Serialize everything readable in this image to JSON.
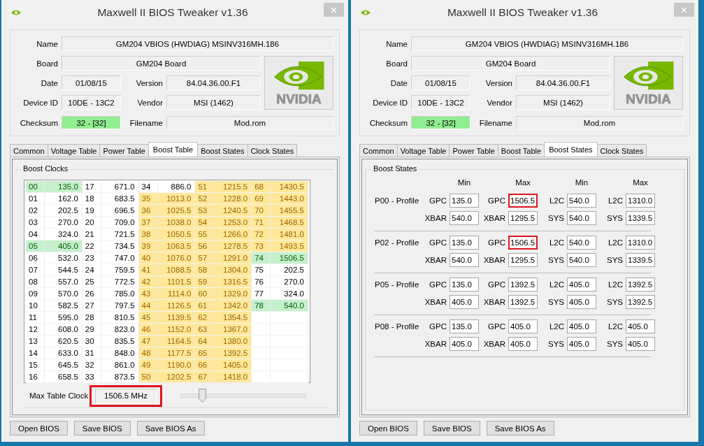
{
  "windows": [
    {
      "title": "Maxwell II BIOS Tweaker v1.36",
      "info": {
        "name": {
          "label": "Name",
          "value": "GM204 VBIOS (HWDIAG) MSINV316MH.186"
        },
        "board": {
          "label": "Board",
          "value": "GM204 Board"
        },
        "date": {
          "label": "Date",
          "value": "01/08/15"
        },
        "version": {
          "label": "Version",
          "value": "84.04.36.00.F1"
        },
        "device_id": {
          "label": "Device ID",
          "value": "10DE - 13C2"
        },
        "vendor": {
          "label": "Vendor",
          "value": "MSI (1462)"
        },
        "checksum": {
          "label": "Checksum",
          "value": "32 - [32]",
          "highlight": true
        },
        "filename": {
          "label": "Filename",
          "value": "Mod.rom"
        },
        "logo_text": "NVIDIA"
      },
      "tabs": [
        {
          "label": "Common",
          "selected": false
        },
        {
          "label": "Voltage Table",
          "selected": false
        },
        {
          "label": "Power Table",
          "selected": false
        },
        {
          "label": "Boost Table",
          "selected": true
        },
        {
          "label": "Boost States",
          "selected": false
        },
        {
          "label": "Clock States",
          "selected": false
        }
      ],
      "panel": {
        "kind": "boost_table",
        "title": "Boost Clocks",
        "entries": [
          {
            "id": "00",
            "clock": "135.0",
            "kind": "marked"
          },
          {
            "id": "01",
            "clock": "162.0",
            "kind": "plain"
          },
          {
            "id": "02",
            "clock": "202.5",
            "kind": "plain"
          },
          {
            "id": "03",
            "clock": "270.0",
            "kind": "plain"
          },
          {
            "id": "04",
            "clock": "324.0",
            "kind": "plain"
          },
          {
            "id": "05",
            "clock": "405.0",
            "kind": "marked"
          },
          {
            "id": "06",
            "clock": "532.0",
            "kind": "plain"
          },
          {
            "id": "07",
            "clock": "544.5",
            "kind": "plain"
          },
          {
            "id": "08",
            "clock": "557.0",
            "kind": "plain"
          },
          {
            "id": "09",
            "clock": "570.0",
            "kind": "plain"
          },
          {
            "id": "10",
            "clock": "582.5",
            "kind": "plain"
          },
          {
            "id": "11",
            "clock": "595.0",
            "kind": "plain"
          },
          {
            "id": "12",
            "clock": "608.0",
            "kind": "plain"
          },
          {
            "id": "13",
            "clock": "620.5",
            "kind": "plain"
          },
          {
            "id": "14",
            "clock": "633.0",
            "kind": "plain"
          },
          {
            "id": "15",
            "clock": "645.5",
            "kind": "plain"
          },
          {
            "id": "16",
            "clock": "658.5",
            "kind": "plain"
          },
          {
            "id": "17",
            "clock": "671.0",
            "kind": "plain"
          },
          {
            "id": "18",
            "clock": "683.5",
            "kind": "plain"
          },
          {
            "id": "19",
            "clock": "696.5",
            "kind": "plain"
          },
          {
            "id": "20",
            "clock": "709.0",
            "kind": "plain"
          },
          {
            "id": "21",
            "clock": "721.5",
            "kind": "plain"
          },
          {
            "id": "22",
            "clock": "734.5",
            "kind": "plain"
          },
          {
            "id": "23",
            "clock": "747.0",
            "kind": "plain"
          },
          {
            "id": "24",
            "clock": "759.5",
            "kind": "plain"
          },
          {
            "id": "25",
            "clock": "772.5",
            "kind": "plain"
          },
          {
            "id": "26",
            "clock": "785.0",
            "kind": "plain"
          },
          {
            "id": "27",
            "clock": "797.5",
            "kind": "plain"
          },
          {
            "id": "28",
            "clock": "810.5",
            "kind": "plain"
          },
          {
            "id": "29",
            "clock": "823.0",
            "kind": "plain"
          },
          {
            "id": "30",
            "clock": "835.5",
            "kind": "plain"
          },
          {
            "id": "31",
            "clock": "848.0",
            "kind": "plain"
          },
          {
            "id": "32",
            "clock": "861.0",
            "kind": "plain"
          },
          {
            "id": "33",
            "clock": "873.5",
            "kind": "plain"
          },
          {
            "id": "34",
            "clock": "886.0",
            "kind": "plain"
          },
          {
            "id": "35",
            "clock": "1013.0",
            "kind": "range"
          },
          {
            "id": "36",
            "clock": "1025.5",
            "kind": "range"
          },
          {
            "id": "37",
            "clock": "1038.0",
            "kind": "range"
          },
          {
            "id": "38",
            "clock": "1050.5",
            "kind": "range"
          },
          {
            "id": "39",
            "clock": "1063.5",
            "kind": "range"
          },
          {
            "id": "40",
            "clock": "1076.0",
            "kind": "range"
          },
          {
            "id": "41",
            "clock": "1088.5",
            "kind": "range"
          },
          {
            "id": "42",
            "clock": "1101.5",
            "kind": "range"
          },
          {
            "id": "43",
            "clock": "1114.0",
            "kind": "range"
          },
          {
            "id": "44",
            "clock": "1126.5",
            "kind": "range"
          },
          {
            "id": "45",
            "clock": "1139.5",
            "kind": "range"
          },
          {
            "id": "46",
            "clock": "1152.0",
            "kind": "range"
          },
          {
            "id": "47",
            "clock": "1164.5",
            "kind": "range"
          },
          {
            "id": "48",
            "clock": "1177.5",
            "kind": "range"
          },
          {
            "id": "49",
            "clock": "1190.0",
            "kind": "range"
          },
          {
            "id": "50",
            "clock": "1202.5",
            "kind": "range"
          },
          {
            "id": "51",
            "clock": "1215.5",
            "kind": "range"
          },
          {
            "id": "52",
            "clock": "1228.0",
            "kind": "range"
          },
          {
            "id": "53",
            "clock": "1240.5",
            "kind": "range"
          },
          {
            "id": "54",
            "clock": "1253.0",
            "kind": "range"
          },
          {
            "id": "55",
            "clock": "1266.0",
            "kind": "range"
          },
          {
            "id": "56",
            "clock": "1278.5",
            "kind": "range"
          },
          {
            "id": "57",
            "clock": "1291.0",
            "kind": "range"
          },
          {
            "id": "58",
            "clock": "1304.0",
            "kind": "range"
          },
          {
            "id": "59",
            "clock": "1316.5",
            "kind": "range"
          },
          {
            "id": "60",
            "clock": "1329.0",
            "kind": "range"
          },
          {
            "id": "61",
            "clock": "1342.0",
            "kind": "range"
          },
          {
            "id": "62",
            "clock": "1354.5",
            "kind": "range"
          },
          {
            "id": "63",
            "clock": "1367.0",
            "kind": "range"
          },
          {
            "id": "64",
            "clock": "1380.0",
            "kind": "range"
          },
          {
            "id": "65",
            "clock": "1392.5",
            "kind": "range"
          },
          {
            "id": "66",
            "clock": "1405.0",
            "kind": "range"
          },
          {
            "id": "67",
            "clock": "1418.0",
            "kind": "range"
          },
          {
            "id": "68",
            "clock": "1430.5",
            "kind": "range"
          },
          {
            "id": "69",
            "clock": "1443.0",
            "kind": "range"
          },
          {
            "id": "70",
            "clock": "1455.5",
            "kind": "range"
          },
          {
            "id": "71",
            "clock": "1468.5",
            "kind": "range"
          },
          {
            "id": "72",
            "clock": "1481.0",
            "kind": "range"
          },
          {
            "id": "73",
            "clock": "1493.5",
            "kind": "range"
          },
          {
            "id": "74",
            "clock": "1506.5",
            "kind": "marked"
          },
          {
            "id": "75",
            "clock": "202.5",
            "kind": "plain"
          },
          {
            "id": "76",
            "clock": "270.0",
            "kind": "plain"
          },
          {
            "id": "77",
            "clock": "324.0",
            "kind": "plain"
          },
          {
            "id": "78",
            "clock": "540.0",
            "kind": "marked"
          }
        ],
        "max_clock": {
          "label": "Max Table Clock",
          "value": "1506.5 MHz",
          "highlighted": true
        },
        "slider": {
          "level": 0.17
        }
      },
      "buttons": [
        "Open BIOS",
        "Save BIOS",
        "Save BIOS As"
      ]
    },
    {
      "title": "Maxwell II BIOS Tweaker v1.36",
      "info": {
        "name": {
          "label": "Name",
          "value": "GM204 VBIOS (HWDIAG) MSINV316MH.186"
        },
        "board": {
          "label": "Board",
          "value": "GM204 Board"
        },
        "date": {
          "label": "Date",
          "value": "01/08/15"
        },
        "version": {
          "label": "Version",
          "value": "84.04.36.00.F1"
        },
        "device_id": {
          "label": "Device ID",
          "value": "10DE - 13C2"
        },
        "vendor": {
          "label": "Vendor",
          "value": "MSI (1462)"
        },
        "checksum": {
          "label": "Checksum",
          "value": "32 - [32]",
          "highlight": true
        },
        "filename": {
          "label": "Filename",
          "value": "Mod.rom"
        },
        "logo_text": "NVIDIA"
      },
      "tabs": [
        {
          "label": "Common",
          "selected": false
        },
        {
          "label": "Voltage Table",
          "selected": false
        },
        {
          "label": "Power Table",
          "selected": false
        },
        {
          "label": "Boost Table",
          "selected": false
        },
        {
          "label": "Boost States",
          "selected": true
        },
        {
          "label": "Clock States",
          "selected": false
        }
      ],
      "panel": {
        "kind": "boost_states",
        "title": "Boost States",
        "headers": [
          "Min",
          "Max",
          "Min",
          "Max"
        ],
        "profiles": [
          {
            "name": "P00 - Profile",
            "rows": [
              [
                {
                  "label": "GPC",
                  "value": "135.0",
                  "highlighted": false
                },
                {
                  "label": "GPC",
                  "value": "1506.5",
                  "highlighted": true
                },
                {
                  "label": "L2C",
                  "value": "540.0",
                  "highlighted": false
                },
                {
                  "label": "L2C",
                  "value": "1310.0",
                  "highlighted": false
                }
              ],
              [
                {
                  "label": "XBAR",
                  "value": "540.0",
                  "highlighted": false
                },
                {
                  "label": "XBAR",
                  "value": "1295.5",
                  "highlighted": false
                },
                {
                  "label": "SYS",
                  "value": "540.0",
                  "highlighted": false
                },
                {
                  "label": "SYS",
                  "value": "1339.5",
                  "highlighted": false
                }
              ]
            ]
          },
          {
            "name": "P02 - Profile",
            "rows": [
              [
                {
                  "label": "GPC",
                  "value": "135.0",
                  "highlighted": false
                },
                {
                  "label": "GPC",
                  "value": "1506.5",
                  "highlighted": true
                },
                {
                  "label": "L2C",
                  "value": "540.0",
                  "highlighted": false
                },
                {
                  "label": "L2C",
                  "value": "1310.0",
                  "highlighted": false
                }
              ],
              [
                {
                  "label": "XBAR",
                  "value": "540.0",
                  "highlighted": false
                },
                {
                  "label": "XBAR",
                  "value": "1295.5",
                  "highlighted": false
                },
                {
                  "label": "SYS",
                  "value": "540.0",
                  "highlighted": false
                },
                {
                  "label": "SYS",
                  "value": "1339.5",
                  "highlighted": false
                }
              ]
            ]
          },
          {
            "name": "P05 - Profile",
            "rows": [
              [
                {
                  "label": "GPC",
                  "value": "135.0",
                  "highlighted": false
                },
                {
                  "label": "GPC",
                  "value": "1392.5",
                  "highlighted": false
                },
                {
                  "label": "L2C",
                  "value": "405.0",
                  "highlighted": false
                },
                {
                  "label": "L2C",
                  "value": "1392.5",
                  "highlighted": false
                }
              ],
              [
                {
                  "label": "XBAR",
                  "value": "405.0",
                  "highlighted": false
                },
                {
                  "label": "XBAR",
                  "value": "1392.5",
                  "highlighted": false
                },
                {
                  "label": "SYS",
                  "value": "405.0",
                  "highlighted": false
                },
                {
                  "label": "SYS",
                  "value": "1392.5",
                  "highlighted": false
                }
              ]
            ]
          },
          {
            "name": "P08 - Profile",
            "rows": [
              [
                {
                  "label": "GPC",
                  "value": "135.0",
                  "highlighted": false
                },
                {
                  "label": "GPC",
                  "value": "405.0",
                  "highlighted": false
                },
                {
                  "label": "L2C",
                  "value": "405.0",
                  "highlighted": false
                },
                {
                  "label": "L2C",
                  "value": "405.0",
                  "highlighted": false
                }
              ],
              [
                {
                  "label": "XBAR",
                  "value": "405.0",
                  "highlighted": false
                },
                {
                  "label": "XBAR",
                  "value": "405.0",
                  "highlighted": false
                },
                {
                  "label": "SYS",
                  "value": "405.0",
                  "highlighted": false
                },
                {
                  "label": "SYS",
                  "value": "405.0",
                  "highlighted": false
                }
              ]
            ]
          }
        ]
      },
      "buttons": [
        "Open BIOS",
        "Save BIOS",
        "Save BIOS As"
      ]
    }
  ]
}
